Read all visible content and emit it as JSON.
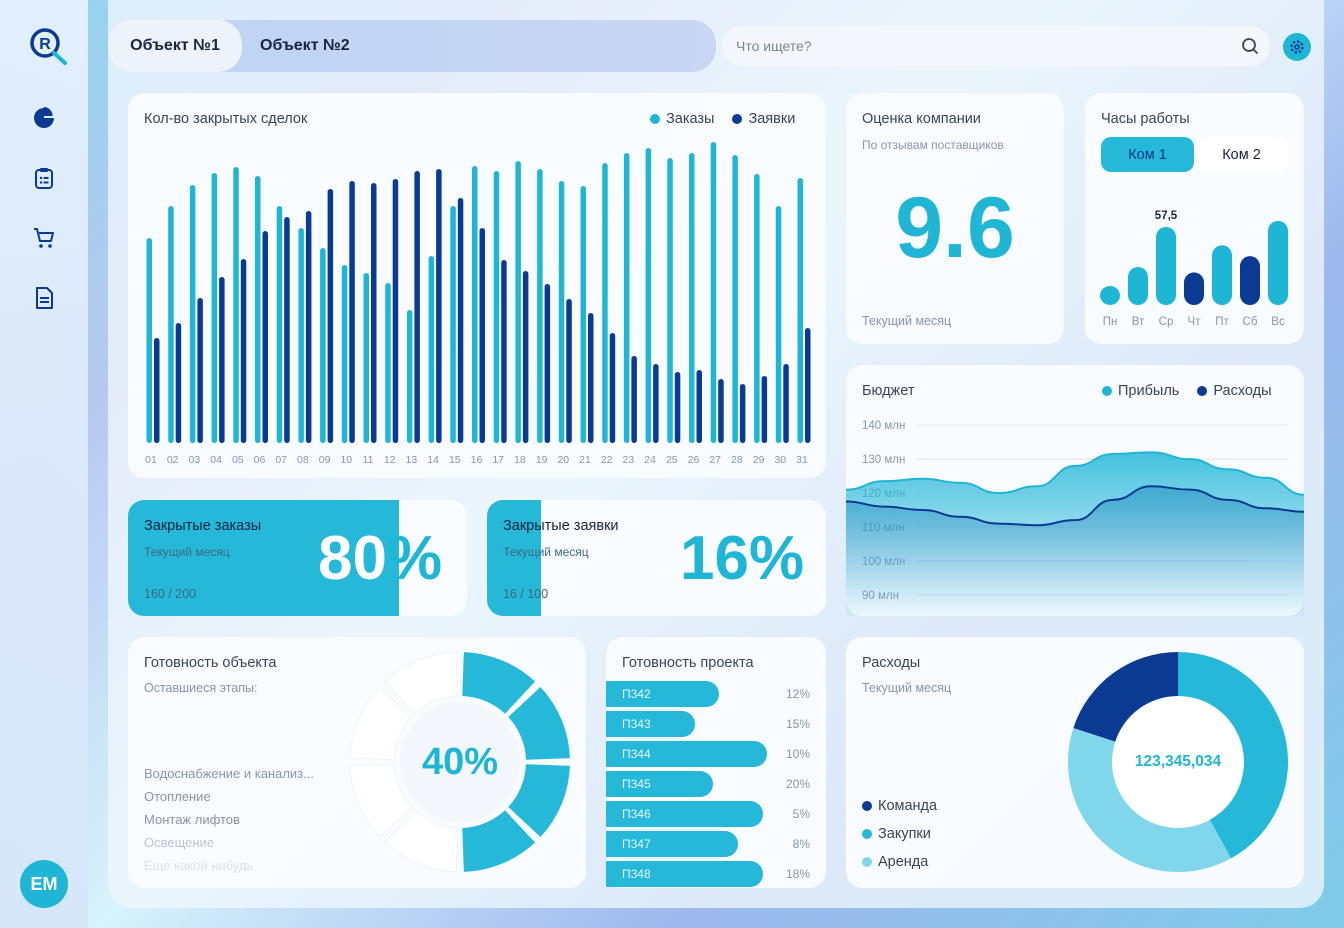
{
  "avatar": {
    "initials": "ЕМ"
  },
  "nav": {
    "items": [
      "pie-chart-icon",
      "clipboard-icon",
      "cart-icon",
      "document-icon"
    ]
  },
  "tabs": [
    {
      "label": "Объект №1"
    },
    {
      "label": "Объект №2"
    }
  ],
  "search": {
    "placeholder": "Что ищете?"
  },
  "deals": {
    "title": "Кол-во закрытых сделок",
    "legend": [
      "Заказы",
      "Заявки"
    ],
    "colors": {
      "orders": "#1fb6d6",
      "requests": "#0a3a91"
    }
  },
  "rating": {
    "title": "Оценка компании",
    "subtitle": "По отзывам поставщиков",
    "value": "9.6",
    "footer": "Текущий месяц"
  },
  "hours": {
    "title": "Часы работы",
    "tabs": [
      "Ком 1",
      "Ком 2"
    ],
    "highlight_label": "57,5"
  },
  "closed_orders": {
    "title": "Закрытые заказы",
    "subtitle": "Текущий месяц",
    "ratio": "160 / 200",
    "percent_label": "80%",
    "fill": 0.8
  },
  "closed_requests": {
    "title": "Закрытые заявки",
    "subtitle": "Текущий месяц",
    "ratio": "16 / 100",
    "percent_label": "16%",
    "fill": 0.16
  },
  "budget": {
    "title": "Бюджет",
    "legend": [
      "Прибыль",
      "Расходы"
    ],
    "y_labels": [
      "140 млн",
      "130 млн",
      "120 млн",
      "110 млн",
      "100 млн",
      "90 млн"
    ]
  },
  "readiness": {
    "title": "Готовность объекта",
    "subtitle": "Оставшиеся этапы:",
    "stages": [
      "Водоснабжение и канализ...",
      "Отопление",
      "Монтаж лифтов",
      "Освещение",
      "Еще какой нибудь"
    ],
    "percent_label": "40%",
    "value": 0.4
  },
  "project": {
    "title": "Готовность проекта",
    "rows": [
      {
        "label": "П342",
        "pct": "12%"
      },
      {
        "label": "П343",
        "pct": "15%"
      },
      {
        "label": "П344",
        "pct": "10%"
      },
      {
        "label": "П345",
        "pct": "20%"
      },
      {
        "label": "П346",
        "pct": "5%"
      },
      {
        "label": "П347",
        "pct": "8%"
      },
      {
        "label": "П348",
        "pct": "18%"
      }
    ]
  },
  "expenses": {
    "title": "Расходы",
    "subtitle": "Текущий месяц",
    "center_value": "123,345,034",
    "legend": [
      {
        "name": "Команда",
        "color": "#0a3a91"
      },
      {
        "name": "Закупки",
        "color": "#26b8d8"
      },
      {
        "name": "Аренда",
        "color": "#80d6ea"
      }
    ]
  },
  "chart_data": [
    {
      "type": "bar",
      "title": "Кол-во закрытых сделок",
      "categories": [
        "01",
        "02",
        "03",
        "04",
        "05",
        "06",
        "07",
        "08",
        "09",
        "10",
        "11",
        "12",
        "13",
        "14",
        "15",
        "16",
        "17",
        "18",
        "19",
        "20",
        "21",
        "22",
        "23",
        "24",
        "25",
        "26",
        "27",
        "28",
        "29",
        "30",
        "31"
      ],
      "series": [
        {
          "name": "Заказы",
          "values": [
            205,
            237,
            258,
            270,
            276,
            267,
            237,
            215,
            195,
            178,
            170,
            160,
            133,
            187,
            237,
            277,
            272,
            282,
            274,
            262,
            257,
            280,
            290,
            295,
            285,
            290,
            301,
            288,
            269,
            237,
            265
          ]
        },
        {
          "name": "Заявки",
          "values": [
            105,
            120,
            145,
            166,
            184,
            212,
            226,
            232,
            254,
            262,
            260,
            264,
            272,
            274,
            245,
            215,
            183,
            172,
            159,
            144,
            130,
            110,
            87,
            79,
            71,
            73,
            64,
            59,
            67,
            79,
            115
          ]
        }
      ],
      "ylim": [
        0,
        310
      ]
    },
    {
      "type": "bar",
      "title": "Часы работы",
      "categories": [
        "Пн",
        "Вт",
        "Ср",
        "Чт",
        "Пт",
        "Сб",
        "Вс"
      ],
      "values": [
        14,
        28,
        57.5,
        24,
        44,
        36,
        62
      ],
      "colors": [
        "#1fb6d6",
        "#1fb6d6",
        "#1fb6d6",
        "#0a3a91",
        "#1fb6d6",
        "#0a3a91",
        "#1fb6d6"
      ]
    },
    {
      "type": "area",
      "title": "Бюджет",
      "x": [
        0,
        1,
        2,
        3,
        4,
        5,
        6,
        7,
        8,
        9,
        10,
        11,
        12
      ],
      "series": [
        {
          "name": "Прибыль",
          "values": [
            121,
            123.5,
            124.2,
            123,
            120,
            122,
            128,
            131.5,
            132,
            130,
            127,
            124.5,
            119.5
          ]
        },
        {
          "name": "Расходы",
          "values": [
            117.5,
            116,
            115,
            113,
            111,
            110.5,
            112,
            118,
            122,
            121,
            118,
            115.5,
            114.5
          ]
        }
      ],
      "ylim": [
        87,
        143
      ],
      "y_ticks": [
        140,
        130,
        120,
        110,
        100,
        90
      ]
    },
    {
      "type": "pie",
      "title": "Расходы",
      "labels": [
        "Команда",
        "Закупки",
        "Аренда"
      ],
      "values": [
        20,
        42,
        38
      ]
    }
  ]
}
